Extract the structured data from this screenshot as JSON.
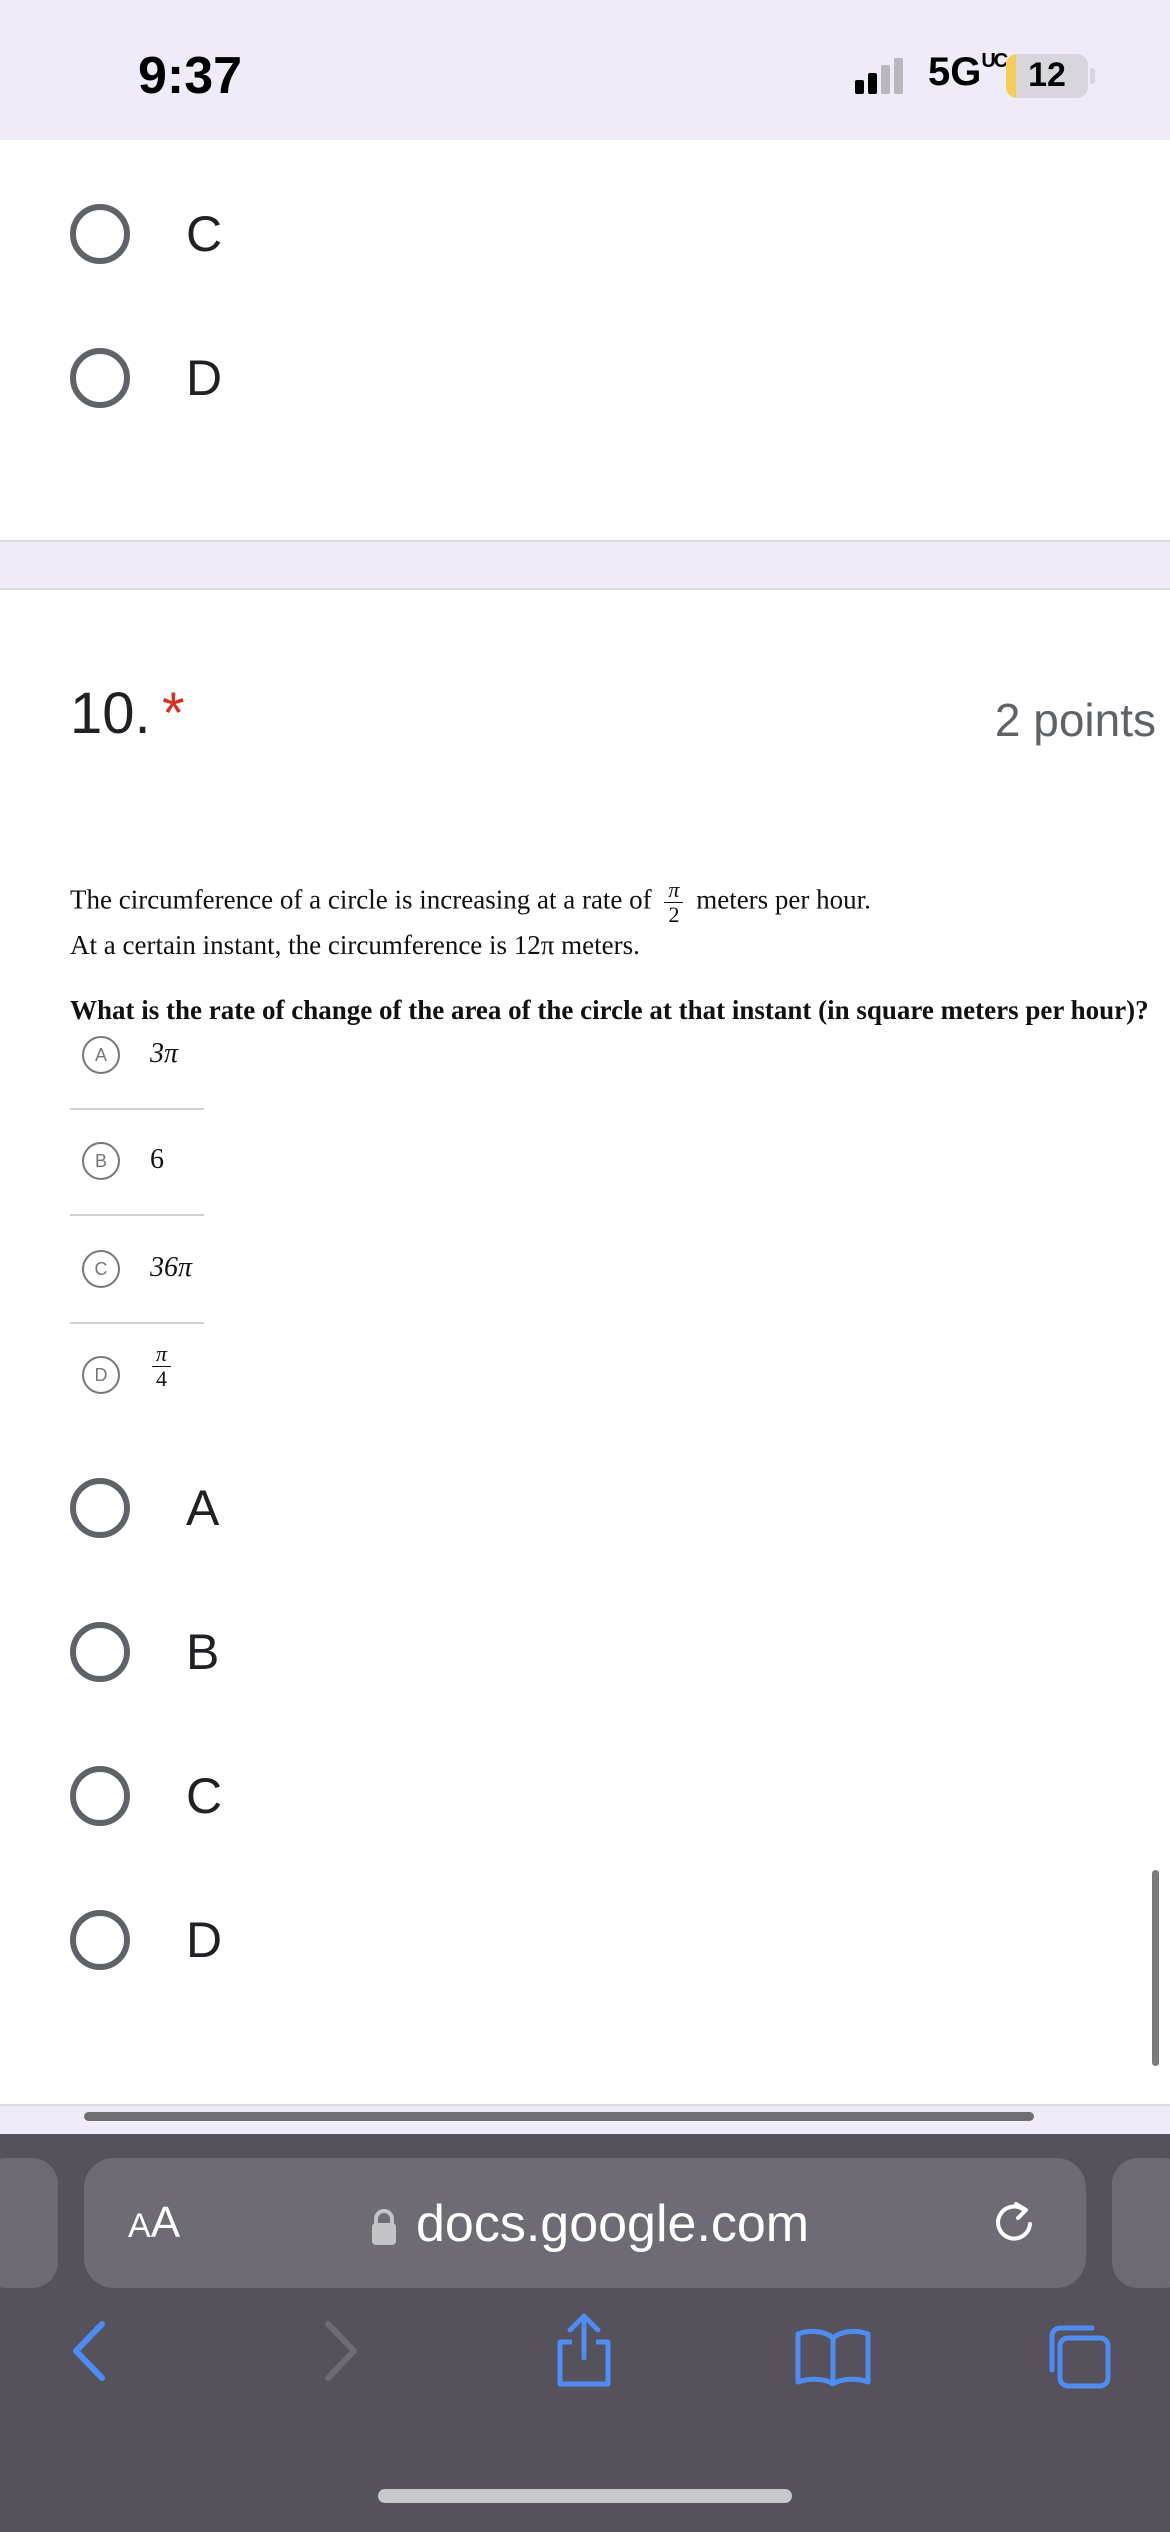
{
  "status_bar": {
    "time": "9:37",
    "network": "5G",
    "network_suffix": "UC",
    "battery_level": 12,
    "battery_text": "12"
  },
  "top_card": {
    "options": [
      {
        "label": "C"
      },
      {
        "label": "D"
      }
    ]
  },
  "question": {
    "number": "10.",
    "required_marker": "*",
    "points": "2 points",
    "image": {
      "line1_before": "The circumference of a circle is increasing at a rate of",
      "fraction_num": "π",
      "fraction_den": "2",
      "line1_after": "meters per hour.",
      "line2": "At a certain instant, the circumference is 12π meters.",
      "line3": "What is the rate of change of the area of the circle at that instant (in square meters per hour)?",
      "choices": [
        {
          "letter": "A",
          "value": "3π"
        },
        {
          "letter": "B",
          "value": "6"
        },
        {
          "letter": "C",
          "value": "36π"
        },
        {
          "letter": "D",
          "num": "π",
          "den": "4"
        }
      ]
    },
    "options": [
      {
        "label": "A"
      },
      {
        "label": "B"
      },
      {
        "label": "C"
      },
      {
        "label": "D"
      }
    ]
  },
  "browser": {
    "aa_label_small": "A",
    "aa_label_large": "A",
    "url": "docs.google.com",
    "icons": [
      "lock-icon",
      "reload-icon",
      "back-icon",
      "forward-icon",
      "share-icon",
      "bookmarks-icon",
      "tabs-icon"
    ]
  },
  "colors": {
    "accent_required": "#d93025",
    "page_background": "#f0ebf8",
    "toolbar": "#55525c"
  }
}
